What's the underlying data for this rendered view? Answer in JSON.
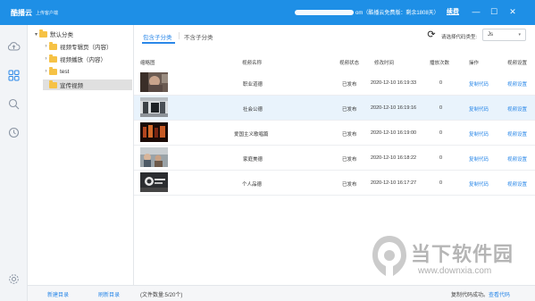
{
  "titlebar": {
    "app_name": "酷播云",
    "app_subtitle": "上传客户端",
    "account_tail": "om（酷播云免费版：剩余1808天）",
    "renew_label": "续费",
    "minimize": "—",
    "maximize": "☐",
    "close": "✕",
    "color": "#1e8fe6"
  },
  "sidebar": {
    "icons": [
      "cloud-upload-icon",
      "apps-grid-icon",
      "search-icon",
      "clock-icon",
      "settings-icon"
    ]
  },
  "tree": {
    "items": [
      {
        "label": "默认分类",
        "caret": "▾"
      },
      {
        "label": "视频专辑页（内容）",
        "caret": "›"
      },
      {
        "label": "视频播放（内容）",
        "caret": "›"
      },
      {
        "label": "test",
        "caret": "›"
      },
      {
        "label": "宣传视频",
        "caret": ""
      }
    ]
  },
  "tabs": {
    "active": "包含子分类",
    "inactive": "不含子分类"
  },
  "code_type": {
    "label": "请选择代码类型:",
    "value": "Js",
    "arrow": "▾"
  },
  "table": {
    "headers": [
      "缩略图",
      "视频名称",
      "视频状态",
      "修改时间",
      "播放次数",
      "操作",
      "视频设置"
    ],
    "rows": [
      {
        "name": "职业道德",
        "status": "已发布",
        "time": "2020-12-10 16:19:33",
        "plays": "0",
        "action": "复制代码",
        "setting": "视频设置"
      },
      {
        "name": "社会公德",
        "status": "已发布",
        "time": "2020-12-10 16:19:16",
        "plays": "0",
        "action": "复制代码",
        "setting": "视频设置"
      },
      {
        "name": "爱国主义歌唱篇",
        "status": "已发布",
        "time": "2020-12-10 16:19:00",
        "plays": "0",
        "action": "复制代码",
        "setting": "视频设置"
      },
      {
        "name": "家庭美德",
        "status": "已发布",
        "time": "2020-12-10 16:18:22",
        "plays": "0",
        "action": "复制代码",
        "setting": "视频设置"
      },
      {
        "name": "个人品德",
        "status": "已发布",
        "time": "2020-12-10 16:17:27",
        "plays": "0",
        "action": "复制代码",
        "setting": "视频设置"
      }
    ]
  },
  "bottom": {
    "new_dir": "新建目录",
    "refresh_dir": "刷新目录",
    "file_count": "(文件数量:5/20个)",
    "copy_status": "复制代码成功。",
    "view_code": "查看代码"
  },
  "watermark": {
    "text": "当下软件园",
    "url": "www.downxia.com"
  }
}
